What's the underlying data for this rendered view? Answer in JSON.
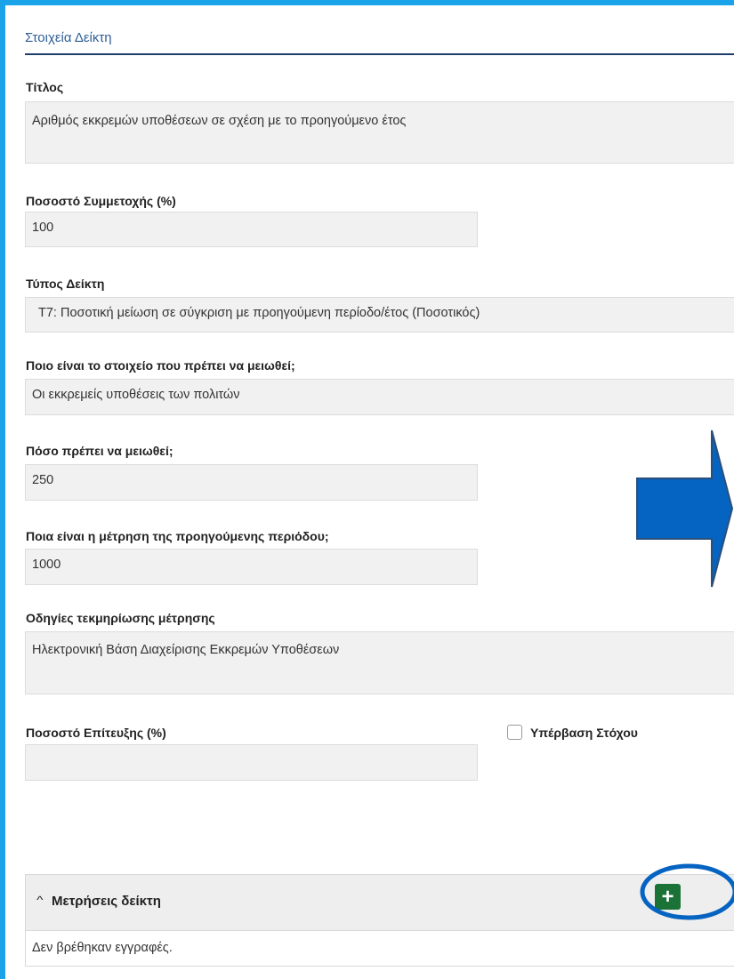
{
  "section": {
    "title": "Στοιχεία Δείκτη"
  },
  "fields": {
    "title_label": "Τίτλος",
    "title_value": "Αριθμός εκκρεμών υποθέσεων σε σχέση με το προηγούμενο έτος",
    "participation_label": "Ποσοστό Συμμετοχής (%)",
    "participation_value": "100",
    "type_label": "Τύπος Δείκτη",
    "type_value": "Τ7: Ποσοτική μείωση σε σύγκριση με προηγούμενη περίοδο/έτος (Ποσοτικός)",
    "element_label": "Ποιο είναι το στοιχείο που πρέπει να μειωθεί;",
    "element_value": "Οι εκκρεμείς υποθέσεις των πολιτών",
    "reduce_label": "Πόσο πρέπει να μειωθεί;",
    "reduce_value": "250",
    "previous_label": "Ποια είναι η μέτρηση της προηγούμενης περιόδου;",
    "previous_value": "1000",
    "docs_label": "Οδηγίες τεκμηρίωσης μέτρησης",
    "docs_value": "Ηλεκτρονική Βάση Διαχείρισης Εκκρεμών Υποθέσεων",
    "achievement_label": "Ποσοστό Επίτευξης (%)",
    "achievement_value": "",
    "exceed_label": "Υπέρβαση Στόχου"
  },
  "measurements": {
    "title": "Μετρήσεις δείκτη",
    "empty_text": "Δεν βρέθηκαν εγγραφές.",
    "add_symbol": "+"
  },
  "colors": {
    "frame": "#1aa3e8",
    "section_title": "#2f5f95",
    "add_button": "#1a7236",
    "annotation_arrow": "#0563c1"
  },
  "icons": {
    "chevron": "chevron-up-icon",
    "add": "plus-icon",
    "arrow": "arrow-right-icon"
  }
}
